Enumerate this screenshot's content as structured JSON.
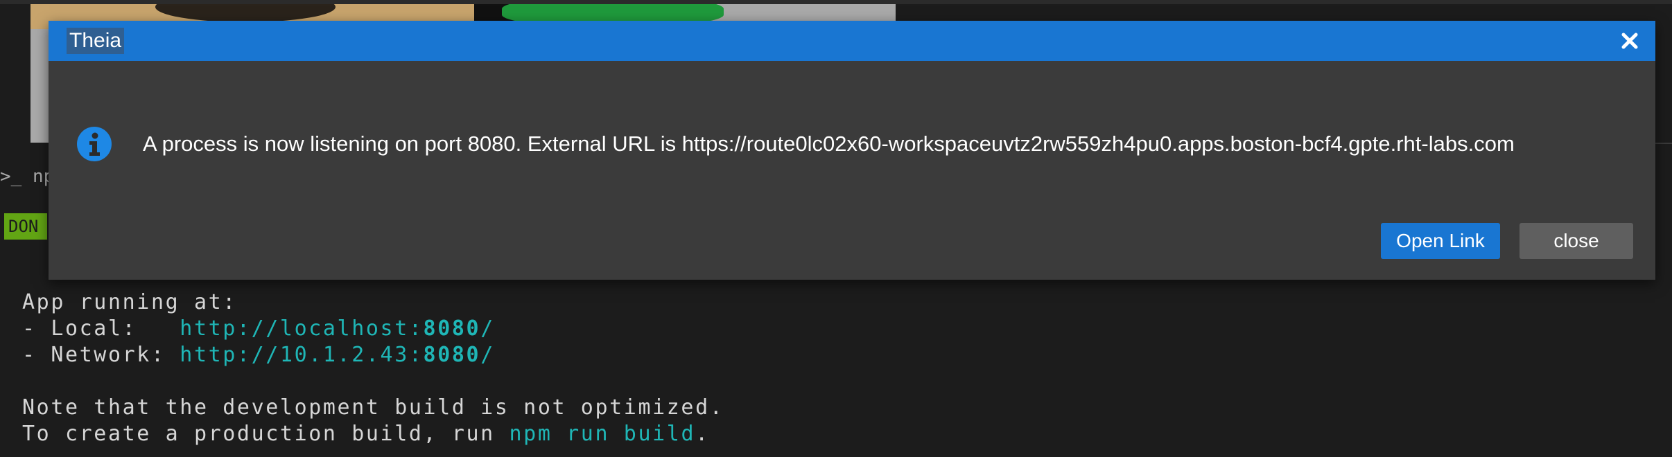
{
  "dialog": {
    "title": "Theia",
    "close_icon": "close-icon",
    "info_icon": "info-icon",
    "message": "A process is now listening on port 8080. External URL is https://route0lc02x60-workspaceuvtz2rw559zh4pu0.apps.boston-bcf4.gpte.rht-labs.com",
    "open_link_label": "Open Link",
    "close_label": "close"
  },
  "terminal_partial": {
    "prompt_text": ">_ np",
    "done_badge": "DON"
  },
  "terminal": {
    "app_running": "App running at:",
    "local_label": "- Local:   ",
    "local_url": "http://localhost:",
    "local_port": "8080",
    "local_slash": "/",
    "network_label": "- Network: ",
    "network_url": "http://10.1.2.43:",
    "network_port": "8080",
    "network_slash": "/",
    "note": "Note that the development build is not optimized.",
    "prod_prefix": "To create a production build, run ",
    "prod_cmd": "npm run build",
    "prod_suffix": "."
  },
  "colors": {
    "titlebar": "#1976d2",
    "dialog_bg": "#3b3b3b",
    "terminal_bg": "#1c1c1c",
    "accent_cyan": "#1fb6b6",
    "done_green": "#62a514"
  }
}
